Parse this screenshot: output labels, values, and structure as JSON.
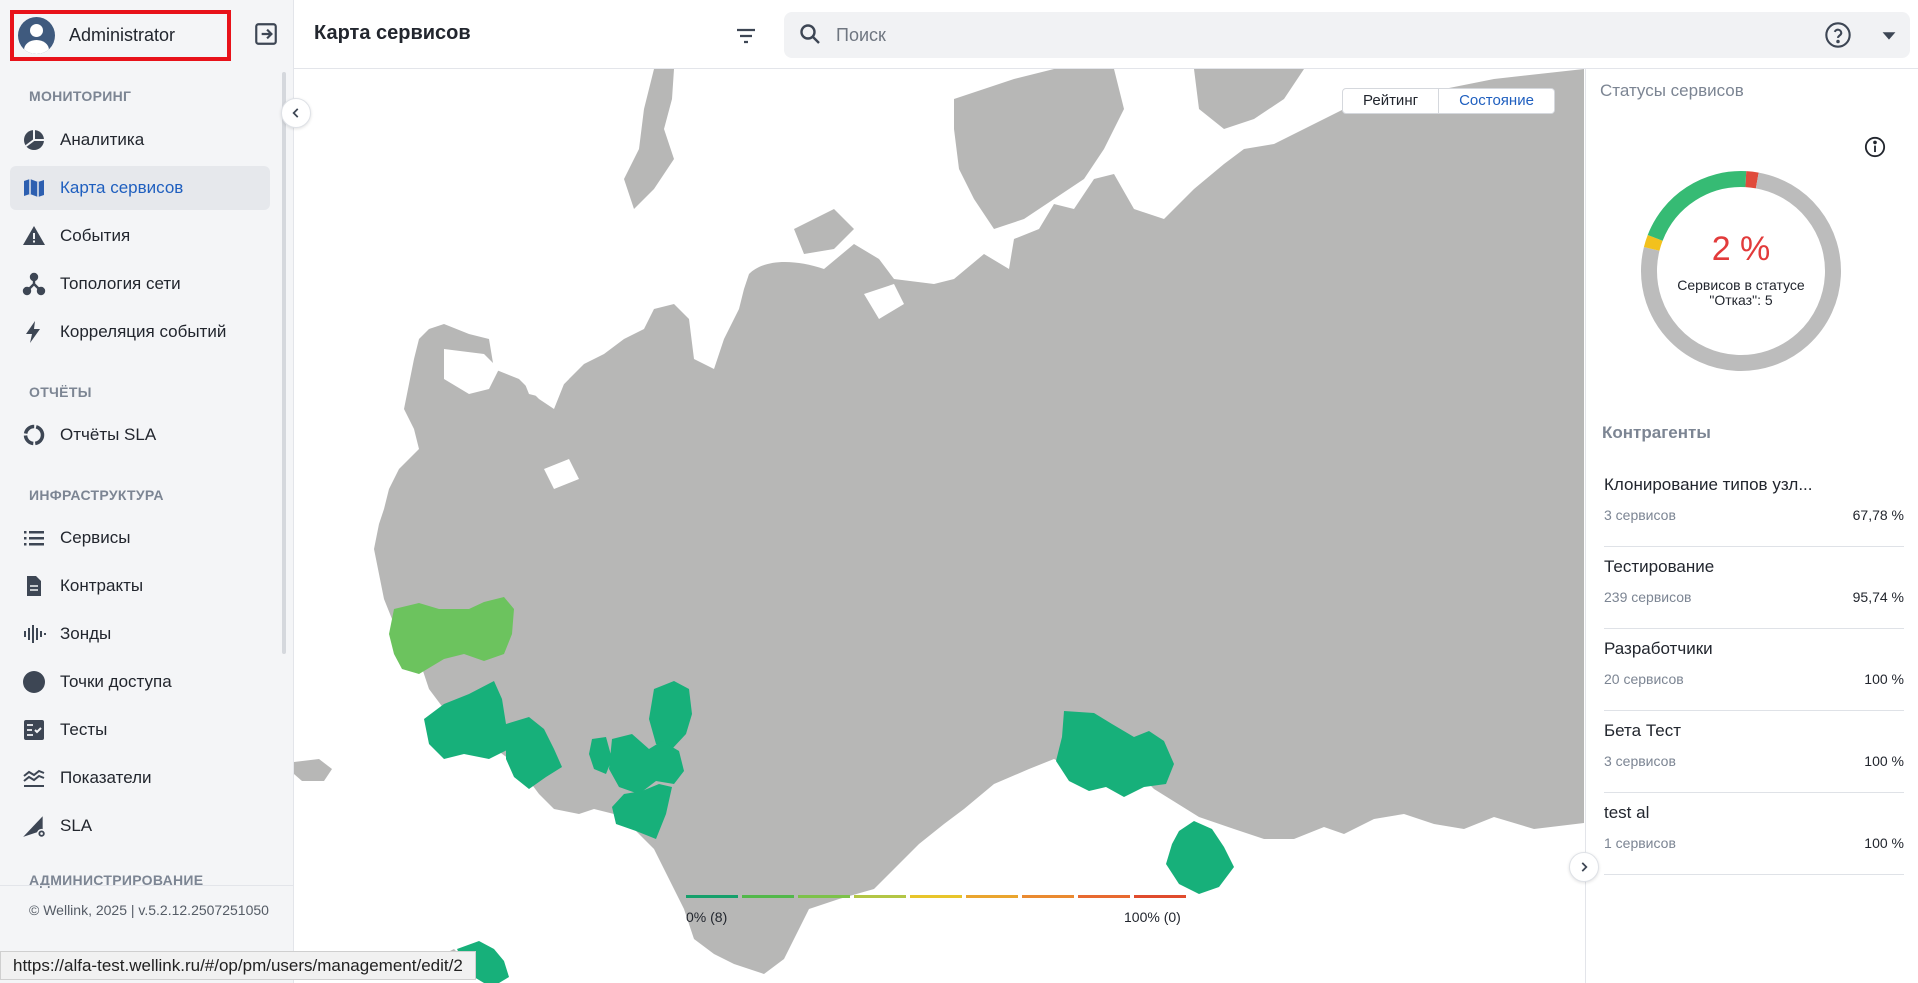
{
  "user": {
    "name": "Administrator"
  },
  "header": {
    "title": "Карта сервисов",
    "search_placeholder": "Поиск"
  },
  "sidebar": {
    "sections": {
      "monitoring": "МОНИТОРИНГ",
      "reports": "ОТЧЁТЫ",
      "infrastructure": "ИНФРАСТРУКТУРА",
      "administration": "АДМИНИСТРИРОВАНИЕ"
    },
    "items": [
      {
        "label": "Аналитика",
        "icon": "pie-chart-icon"
      },
      {
        "label": "Карта сервисов",
        "icon": "map-icon",
        "active": true
      },
      {
        "label": "События",
        "icon": "warning-icon"
      },
      {
        "label": "Топология сети",
        "icon": "topology-icon"
      },
      {
        "label": "Корреляция событий",
        "icon": "bolt-icon"
      },
      {
        "label": "Отчёты SLA",
        "icon": "ring-chart-icon"
      },
      {
        "label": "Сервисы",
        "icon": "list-icon"
      },
      {
        "label": "Контракты",
        "icon": "document-icon"
      },
      {
        "label": "Зонды",
        "icon": "probe-icon"
      },
      {
        "label": "Точки доступа",
        "icon": "circle-icon"
      },
      {
        "label": "Тесты",
        "icon": "checklist-icon"
      },
      {
        "label": "Показатели",
        "icon": "metrics-icon"
      },
      {
        "label": "SLA",
        "icon": "sla-icon"
      }
    ],
    "copyright": "© Wellink, 2025 | v.5.2.12.2507251050"
  },
  "status_bar": {
    "url": "https://alfa-test.wellink.ru/#/op/pm/users/management/edit/2"
  },
  "map": {
    "toggle": {
      "rating": "Рейтинг",
      "state": "Состояние",
      "selected": "state"
    },
    "legend": {
      "min_label": "0% (8)",
      "max_label": "100% (0)",
      "colors": [
        "#15a06b",
        "#52b84a",
        "#7dc24a",
        "#b3c645",
        "#e8c52a",
        "#eaa52e",
        "#ea8a30",
        "#e86a30",
        "#e04b2d"
      ]
    },
    "colors": {
      "land": "#b7b7b6",
      "region_ok": "#17b07a",
      "region_light": "#6cc35e"
    }
  },
  "right_panel": {
    "title": "Статусы сервисов",
    "donut": {
      "percent_text": "2 %",
      "subtitle": "Сервисов в статусе \"Отказ\": 5",
      "segments": [
        {
          "status": "fail",
          "fraction": 0.02,
          "color": "#e04b3c"
        },
        {
          "status": "gray",
          "fraction": 0.76,
          "color": "#bcbcbc"
        },
        {
          "status": "warning",
          "fraction": 0.02,
          "color": "#f2c11d"
        },
        {
          "status": "ok",
          "fraction": 0.2,
          "color": "#36bb74"
        }
      ]
    },
    "contractors_title": "Контрагенты",
    "contractors": [
      {
        "name": "Клонирование типов узл...",
        "count": "3 сервисов",
        "pct": "67,78 %"
      },
      {
        "name": "Тестирование",
        "count": "239 сервисов",
        "pct": "95,74 %"
      },
      {
        "name": "Разработчики",
        "count": "20 сервисов",
        "pct": "100 %"
      },
      {
        "name": "Бета Тест",
        "count": "3 сервисов",
        "pct": "100 %"
      },
      {
        "name": "test al",
        "count": "1 сервисов",
        "pct": "100 %"
      }
    ]
  }
}
